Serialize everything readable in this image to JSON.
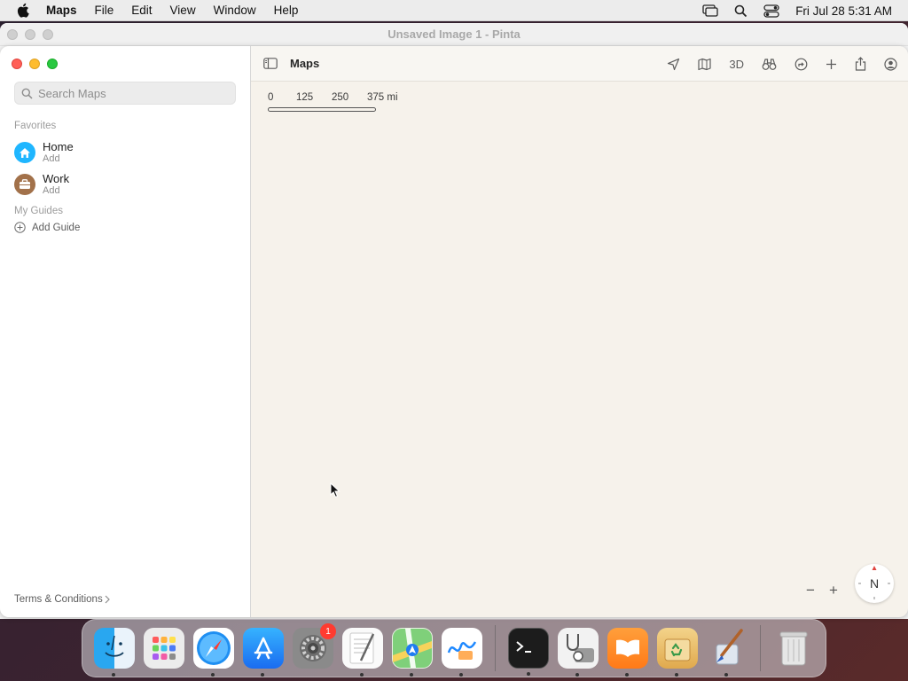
{
  "menubar": {
    "app_name": "Maps",
    "items": [
      "File",
      "Edit",
      "View",
      "Window",
      "Help"
    ],
    "datetime": "Fri Jul 28  5:31 AM"
  },
  "pinta_window": {
    "title": "Unsaved Image 1 - Pinta"
  },
  "maps": {
    "title": "Maps",
    "search_placeholder": "Search Maps",
    "favorites_header": "Favorites",
    "favorites": [
      {
        "name": "Home",
        "sub": "Add",
        "icon": "house-icon",
        "color": "#1fb6ff"
      },
      {
        "name": "Work",
        "sub": "Add",
        "icon": "briefcase-icon",
        "color": "#a2714a"
      }
    ],
    "guides_header": "My Guides",
    "add_guide": "Add Guide",
    "terms": "Terms & Conditions",
    "toolbar_3d": "3D",
    "scale_labels": [
      "0",
      "125",
      "250",
      "375 mi"
    ],
    "compass": "N",
    "zoom_out": "−",
    "zoom_in": "+"
  },
  "dock": {
    "apps": [
      "Finder",
      "Launchpad",
      "Safari",
      "App Store",
      "System Settings",
      "TextEdit",
      "Maps",
      "Freeform",
      "Terminal",
      "Disk Utility",
      "Books",
      "Archive Utility",
      "Pinta",
      "Trash"
    ],
    "settings_badge": "1"
  }
}
